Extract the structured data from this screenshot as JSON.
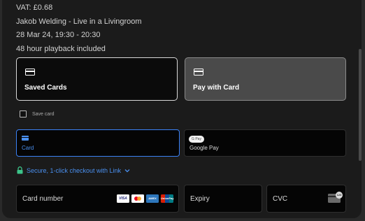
{
  "order": {
    "vat": "VAT: £0.68",
    "event": "Jakob Welding - Live in a Livingroom",
    "datetime": "28 Mar 24, 19:30 - 20:30",
    "playback": "48 hour playback included"
  },
  "payment_methods": [
    {
      "label": "Saved Cards",
      "icon": "credit-card-icon",
      "selected": false
    },
    {
      "label": "Pay with Card",
      "icon": "credit-card-icon",
      "selected": true
    }
  ],
  "save_card": {
    "label": "Save card",
    "checked": false
  },
  "tabs": [
    {
      "label": "Card",
      "icon": "credit-card-icon",
      "selected": true
    },
    {
      "label": "Google Pay",
      "icon": "google-pay-icon",
      "badge": "G Pay",
      "selected": false
    }
  ],
  "link_checkout": {
    "label": "Secure, 1-click checkout with Link",
    "icon": "lock-icon"
  },
  "fields": {
    "card_number": {
      "label": "Card number"
    },
    "expiry": {
      "label": "Expiry"
    },
    "cvc": {
      "label": "CVC",
      "badge": "123"
    }
  },
  "card_brands": [
    {
      "name": "visa",
      "text": "VISA"
    },
    {
      "name": "mastercard",
      "text": ""
    },
    {
      "name": "amex",
      "text": "AMEX"
    },
    {
      "name": "unionpay",
      "text": "UnionPay"
    }
  ],
  "colors": {
    "accent": "#3b82f6",
    "link": "#4a90f0",
    "background": "#1b1b1b"
  }
}
